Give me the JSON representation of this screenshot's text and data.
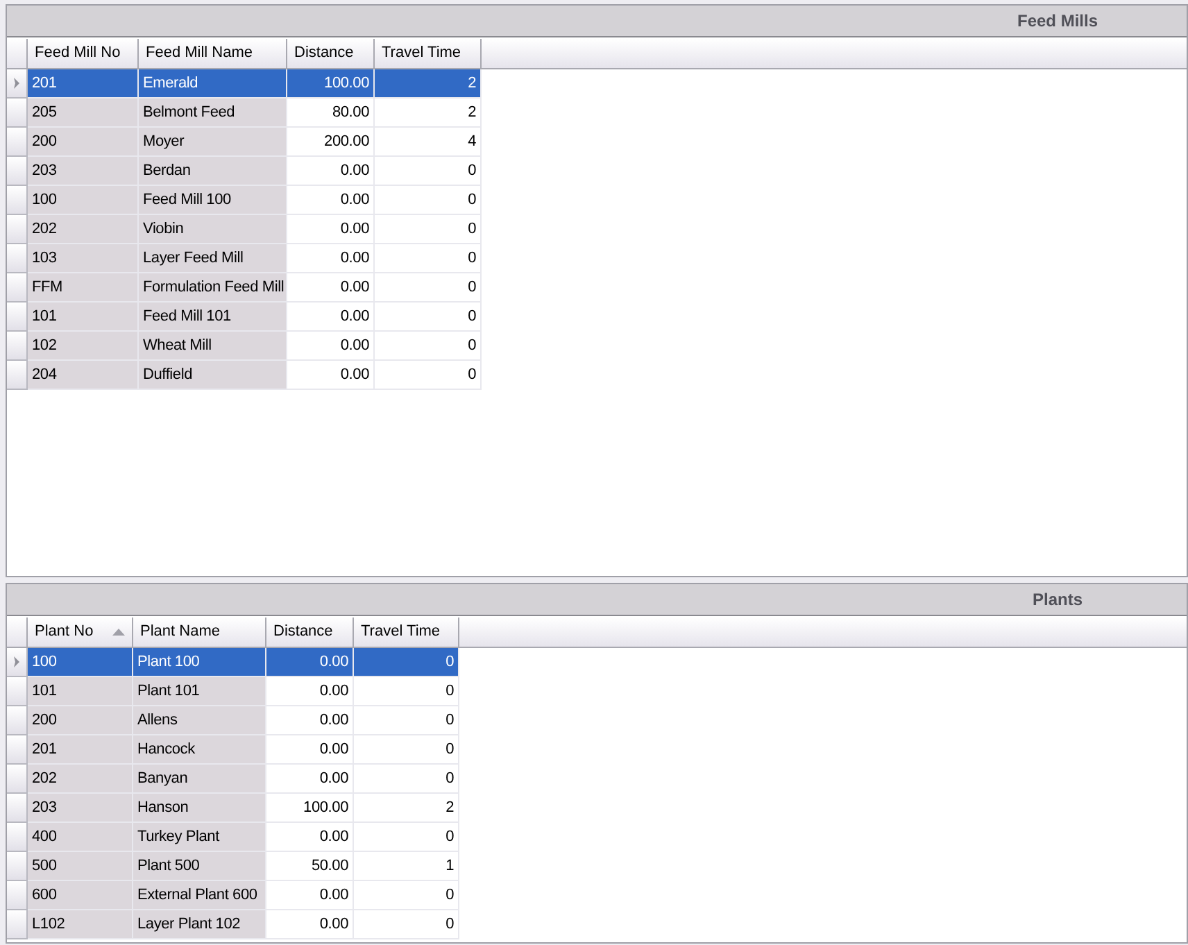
{
  "panels": [
    {
      "title": "Feed Mills",
      "columns": [
        {
          "label": "Feed Mill No",
          "sorted": false
        },
        {
          "label": "Feed Mill Name",
          "sorted": false
        },
        {
          "label": "Distance",
          "sorted": false
        },
        {
          "label": "Travel Time",
          "sorted": false
        }
      ],
      "rows": [
        {
          "cells": [
            "201",
            "Emerald",
            "100.00",
            "2"
          ],
          "selected": true
        },
        {
          "cells": [
            "205",
            "Belmont Feed",
            "80.00",
            "2"
          ],
          "selected": false
        },
        {
          "cells": [
            "200",
            "Moyer",
            "200.00",
            "4"
          ],
          "selected": false
        },
        {
          "cells": [
            "203",
            "Berdan",
            "0.00",
            "0"
          ],
          "selected": false
        },
        {
          "cells": [
            "100",
            "Feed Mill 100",
            "0.00",
            "0"
          ],
          "selected": false
        },
        {
          "cells": [
            "202",
            "Viobin",
            "0.00",
            "0"
          ],
          "selected": false
        },
        {
          "cells": [
            "103",
            "Layer Feed Mill",
            "0.00",
            "0"
          ],
          "selected": false
        },
        {
          "cells": [
            "FFM",
            "Formulation Feed Mill",
            "0.00",
            "0"
          ],
          "selected": false
        },
        {
          "cells": [
            "101",
            "Feed Mill 101",
            "0.00",
            "0"
          ],
          "selected": false
        },
        {
          "cells": [
            "102",
            "Wheat Mill",
            "0.00",
            "0"
          ],
          "selected": false
        },
        {
          "cells": [
            "204",
            "Duffield",
            "0.00",
            "0"
          ],
          "selected": false
        }
      ]
    },
    {
      "title": "Plants",
      "columns": [
        {
          "label": "Plant No",
          "sorted": true
        },
        {
          "label": "Plant Name",
          "sorted": false
        },
        {
          "label": "Distance",
          "sorted": false
        },
        {
          "label": "Travel Time",
          "sorted": false
        }
      ],
      "rows": [
        {
          "cells": [
            "100",
            "Plant 100",
            "0.00",
            "0"
          ],
          "selected": true
        },
        {
          "cells": [
            "101",
            "Plant 101",
            "0.00",
            "0"
          ],
          "selected": false
        },
        {
          "cells": [
            "200",
            "Allens",
            "0.00",
            "0"
          ],
          "selected": false
        },
        {
          "cells": [
            "201",
            "Hancock",
            "0.00",
            "0"
          ],
          "selected": false
        },
        {
          "cells": [
            "202",
            "Banyan",
            "0.00",
            "0"
          ],
          "selected": false
        },
        {
          "cells": [
            "203",
            "Hanson",
            "100.00",
            "2"
          ],
          "selected": false
        },
        {
          "cells": [
            "400",
            "Turkey Plant",
            "0.00",
            "0"
          ],
          "selected": false
        },
        {
          "cells": [
            "500",
            "Plant 500",
            "50.00",
            "1"
          ],
          "selected": false
        },
        {
          "cells": [
            "600",
            "External Plant 600",
            "0.00",
            "0"
          ],
          "selected": false
        },
        {
          "cells": [
            "L102",
            "Layer Plant 102",
            "0.00",
            "0"
          ],
          "selected": false
        }
      ]
    }
  ]
}
